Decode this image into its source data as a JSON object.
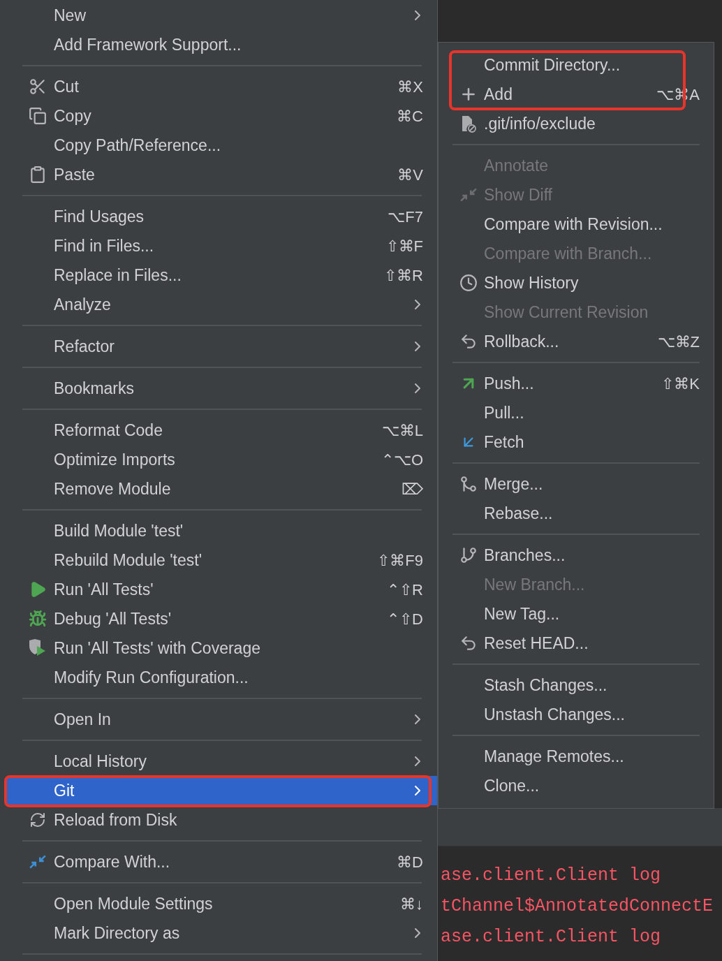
{
  "main_menu": {
    "groups": [
      {
        "items": [
          {
            "label": "New",
            "has_submenu": true,
            "selected": false,
            "highlighted": false
          },
          {
            "label": "Add Framework Support...",
            "has_submenu": false,
            "selected": false,
            "highlighted": false
          }
        ]
      },
      {
        "items": [
          {
            "label": "Cut",
            "shortcut": "⌘X",
            "has_submenu": false,
            "selected": false,
            "highlighted": false
          },
          {
            "label": "Copy",
            "shortcut": "⌘C",
            "has_submenu": false,
            "selected": false,
            "highlighted": false
          },
          {
            "label": "Copy Path/Reference...",
            "has_submenu": false,
            "selected": false,
            "highlighted": false
          },
          {
            "label": "Paste",
            "shortcut": "⌘V",
            "has_submenu": false,
            "selected": false,
            "highlighted": false
          }
        ]
      },
      {
        "items": [
          {
            "label": "Find Usages",
            "shortcut": "⌥F7",
            "has_submenu": false,
            "selected": false,
            "highlighted": false
          },
          {
            "label": "Find in Files...",
            "shortcut": "⇧⌘F",
            "has_submenu": false,
            "selected": false,
            "highlighted": false
          },
          {
            "label": "Replace in Files...",
            "shortcut": "⇧⌘R",
            "has_submenu": false,
            "selected": false,
            "highlighted": false
          },
          {
            "label": "Analyze",
            "has_submenu": true,
            "selected": false,
            "highlighted": false
          }
        ]
      },
      {
        "items": [
          {
            "label": "Refactor",
            "has_submenu": true,
            "selected": false,
            "highlighted": false
          }
        ]
      },
      {
        "items": [
          {
            "label": "Bookmarks",
            "has_submenu": true,
            "selected": false,
            "highlighted": false
          }
        ]
      },
      {
        "items": [
          {
            "label": "Reformat Code",
            "shortcut": "⌥⌘L",
            "has_submenu": false,
            "selected": false,
            "highlighted": false
          },
          {
            "label": "Optimize Imports",
            "shortcut": "⌃⌥O",
            "has_submenu": false,
            "selected": false,
            "highlighted": false
          },
          {
            "label": "Remove Module",
            "shortcut": "⌦",
            "has_submenu": false,
            "selected": false,
            "highlighted": false
          }
        ]
      },
      {
        "items": [
          {
            "label": "Build Module 'test'",
            "has_submenu": false,
            "selected": false,
            "highlighted": false
          },
          {
            "label": "Rebuild Module 'test'",
            "shortcut": "⇧⌘F9",
            "has_submenu": false,
            "selected": false,
            "highlighted": false
          },
          {
            "label": "Run 'All Tests'",
            "shortcut": "⌃⇧R",
            "has_submenu": false,
            "selected": false,
            "highlighted": false
          },
          {
            "label": "Debug 'All Tests'",
            "shortcut": "⌃⇧D",
            "has_submenu": false,
            "selected": false,
            "highlighted": false
          },
          {
            "label": "Run 'All Tests' with Coverage",
            "has_submenu": false,
            "selected": false,
            "highlighted": false
          },
          {
            "label": "Modify Run Configuration...",
            "has_submenu": false,
            "selected": false,
            "highlighted": false
          }
        ]
      },
      {
        "items": [
          {
            "label": "Open In",
            "has_submenu": true,
            "selected": false,
            "highlighted": false
          }
        ]
      },
      {
        "items": [
          {
            "label": "Local History",
            "has_submenu": true,
            "selected": false,
            "highlighted": false
          },
          {
            "label": "Git",
            "has_submenu": true,
            "selected": true,
            "highlighted": true
          },
          {
            "label": "Reload from Disk",
            "has_submenu": false,
            "selected": false,
            "highlighted": false
          }
        ]
      },
      {
        "items": [
          {
            "label": "Compare With...",
            "shortcut": "⌘D",
            "has_submenu": false,
            "selected": false,
            "highlighted": false
          }
        ]
      },
      {
        "items": [
          {
            "label": "Open Module Settings",
            "shortcut": "⌘↓",
            "has_submenu": false,
            "selected": false,
            "highlighted": false
          },
          {
            "label": "Mark Directory as",
            "has_submenu": true,
            "selected": false,
            "highlighted": false
          }
        ]
      }
    ]
  },
  "git_submenu": {
    "groups": [
      {
        "items": [
          {
            "label": "Commit Directory...",
            "disabled": false,
            "highlighted": true
          },
          {
            "label": "Add",
            "shortcut": "⌥⌘A",
            "disabled": false,
            "highlighted": true
          },
          {
            "label": ".git/info/exclude",
            "disabled": false,
            "highlighted": false
          }
        ]
      },
      {
        "items": [
          {
            "label": "Annotate",
            "disabled": true,
            "highlighted": false
          },
          {
            "label": "Show Diff",
            "disabled": true,
            "highlighted": false
          },
          {
            "label": "Compare with Revision...",
            "disabled": false,
            "highlighted": false
          },
          {
            "label": "Compare with Branch...",
            "disabled": true,
            "highlighted": false
          },
          {
            "label": "Show History",
            "disabled": false,
            "highlighted": false
          },
          {
            "label": "Show Current Revision",
            "disabled": true,
            "highlighted": false
          },
          {
            "label": "Rollback...",
            "shortcut": "⌥⌘Z",
            "disabled": false,
            "highlighted": false
          }
        ]
      },
      {
        "items": [
          {
            "label": "Push...",
            "shortcut": "⇧⌘K",
            "disabled": false,
            "highlighted": false
          },
          {
            "label": "Pull...",
            "disabled": false,
            "highlighted": false
          },
          {
            "label": "Fetch",
            "disabled": false,
            "highlighted": false
          }
        ]
      },
      {
        "items": [
          {
            "label": "Merge...",
            "disabled": false,
            "highlighted": false
          },
          {
            "label": "Rebase...",
            "disabled": false,
            "highlighted": false
          }
        ]
      },
      {
        "items": [
          {
            "label": "Branches...",
            "disabled": false,
            "highlighted": false
          },
          {
            "label": "New Branch...",
            "disabled": true,
            "highlighted": false
          },
          {
            "label": "New Tag...",
            "disabled": false,
            "highlighted": false
          },
          {
            "label": "Reset HEAD...",
            "disabled": false,
            "highlighted": false
          }
        ]
      },
      {
        "items": [
          {
            "label": "Stash Changes...",
            "disabled": false,
            "highlighted": false
          },
          {
            "label": "Unstash Changes...",
            "disabled": false,
            "highlighted": false
          }
        ]
      },
      {
        "items": [
          {
            "label": "Manage Remotes...",
            "disabled": false,
            "highlighted": false
          },
          {
            "label": "Clone...",
            "disabled": false,
            "highlighted": false
          }
        ]
      }
    ]
  },
  "console": {
    "lines": [
      "ase.client.Client log",
      "tChannel$AnnotatedConnectE",
      "ase.client.Client log"
    ]
  }
}
